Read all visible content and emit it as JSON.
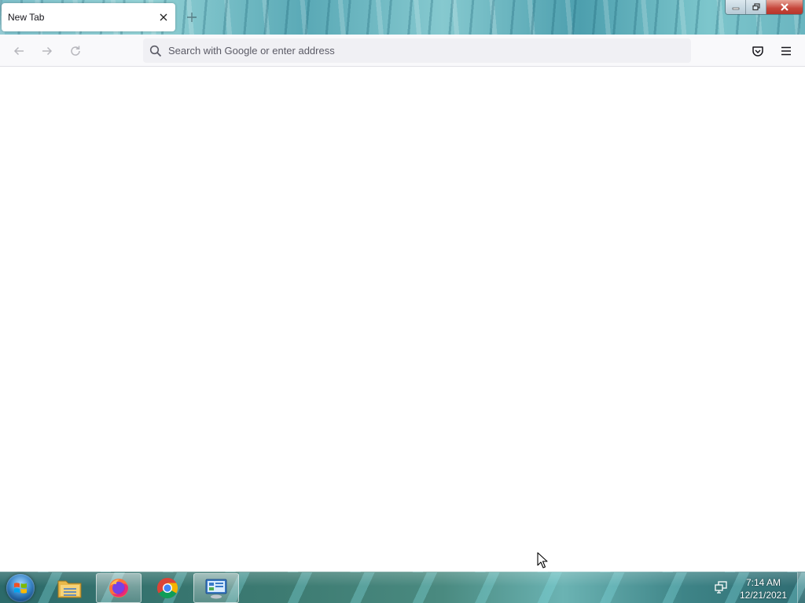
{
  "window": {
    "tab": {
      "title": "New Tab",
      "close_icon": "close-icon"
    },
    "new_tab_icon": "plus-icon",
    "caption": {
      "minimize": "minimize-icon",
      "restore": "restore-icon",
      "close": "close-icon"
    }
  },
  "navbar": {
    "back_icon": "back-arrow-icon",
    "forward_icon": "forward-arrow-icon",
    "reload_icon": "reload-icon",
    "urlbar": {
      "placeholder": "Search with Google or enter address",
      "value": "",
      "icon": "search-icon"
    },
    "pocket_icon": "pocket-icon",
    "menu_icon": "hamburger-menu-icon"
  },
  "taskbar": {
    "start_icon": "windows-start-icon",
    "items": [
      {
        "name": "file-explorer",
        "icon": "folder-icon",
        "active": false
      },
      {
        "name": "firefox",
        "icon": "firefox-icon",
        "active": true
      },
      {
        "name": "chrome",
        "icon": "chrome-icon",
        "active": false
      },
      {
        "name": "control-panel",
        "icon": "control-panel-icon",
        "active": true
      }
    ],
    "tray": {
      "network_icon": "network-icon",
      "time": "7:14 AM",
      "date": "12/21/2021"
    }
  },
  "colors": {
    "tab_bg": "#ffffff",
    "navbar_bg": "#f9f9fb",
    "urlbar_bg": "#f0f0f4",
    "close_button_red": "#c5453a"
  }
}
